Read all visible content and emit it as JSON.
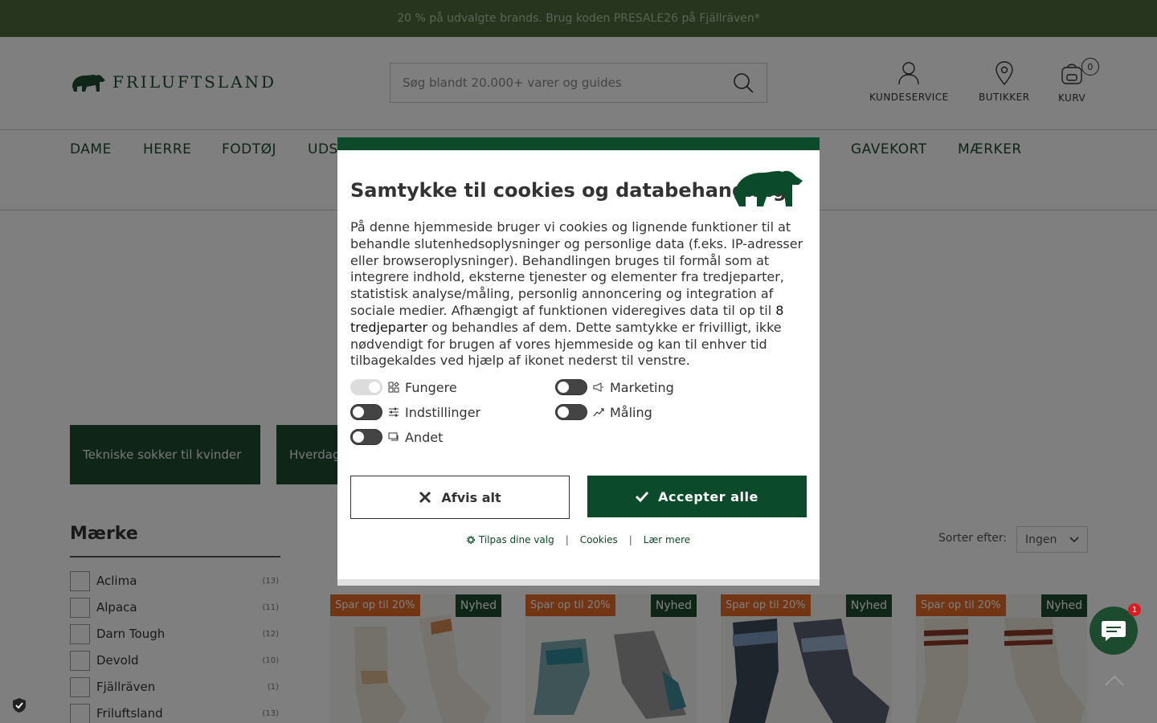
{
  "promo": {
    "text": "20 % på udvalgte brands. Brug koden PRESALE26 på Fjällräven*"
  },
  "header": {
    "logo_text": "FRILUFTSLAND",
    "search_placeholder": "Søg blandt 20.000+ varer og guides",
    "customer_service": "KUNDESERVICE",
    "stores": "BUTIKKER",
    "cart": "KURV",
    "cart_count": "0"
  },
  "nav": [
    {
      "label": "DAME"
    },
    {
      "label": "HERRE"
    },
    {
      "label": "FODTØJ"
    },
    {
      "label": "UDS"
    },
    {
      "label": "GAVEKORT"
    },
    {
      "label": "MÆRKER"
    }
  ],
  "categories": [
    {
      "label": "Tekniske sokker til kvinder"
    },
    {
      "label": "Hverdag"
    }
  ],
  "facets": {
    "title": "Mærke",
    "items": [
      {
        "label": "Aclima",
        "count": "(13)"
      },
      {
        "label": "Alpaca",
        "count": "(11)"
      },
      {
        "label": "Darn Tough",
        "count": "(12)"
      },
      {
        "label": "Devold",
        "count": "(10)"
      },
      {
        "label": "Fjällräven",
        "count": "(1)"
      },
      {
        "label": "Friluftsland",
        "count": "(13)"
      }
    ]
  },
  "sort": {
    "label": "Sorter efter:",
    "value": "Ingen"
  },
  "products": [
    {
      "sale_badge": "Spar op til 20%",
      "new_badge": "Nyhed"
    },
    {
      "sale_badge": "Spar op til 20%",
      "new_badge": "Nyhed"
    },
    {
      "sale_badge": "Spar op til 20%",
      "new_badge": "Nyhed"
    },
    {
      "sale_badge": "Spar op til 20%",
      "new_badge": "Nyhed"
    }
  ],
  "chat": {
    "badge_count": "1"
  },
  "consent": {
    "title": "Samtykke til cookies og databehandling",
    "body_part1": "På denne hjemmeside bruger vi cookies og lignende funktioner til at behandle slutenhedsoplysninger og personlige data (f.eks. IP-adresser eller browseroplysninger). Behandlingen bruges til formål som at integrere indhold, eksterne tjenester og elementer fra tredjeparter, statistisk analyse/måling, personlig annoncering og integration af sociale medier. Afhængigt af funktionen videregives data til op til ",
    "body_link": "8 tredjeparter",
    "body_part2": " og behandles af dem. Dette samtykke er frivilligt, ikke nødvendigt for brugen af vores hjemmeside og kan til enhver tid tilbagekaldes ved hjælp af ikonet nederst til venstre.",
    "toggles": {
      "functional": "Fungere",
      "marketing": "Marketing",
      "preferences": "Indstillinger",
      "measurement": "Måling",
      "other": "Andet"
    },
    "deny_label": "Afvis alt",
    "accept_label": "Accepter alle",
    "customize_label": "Tilpas dine valg",
    "cookies_label": "Cookies",
    "learn_more_label": "Lær mere",
    "link_separator": "|"
  }
}
